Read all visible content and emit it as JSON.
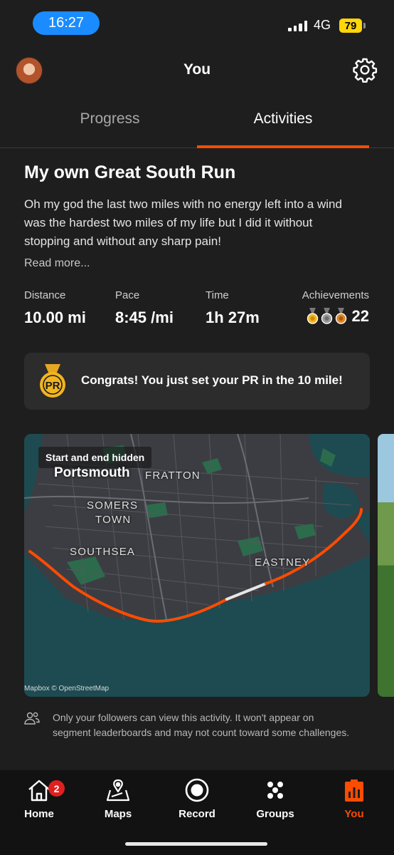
{
  "status_bar": {
    "time": "16:27",
    "network": "4G",
    "battery": "79"
  },
  "header": {
    "title": "You"
  },
  "tabs": [
    {
      "label": "Progress",
      "active": false
    },
    {
      "label": "Activities",
      "active": true
    }
  ],
  "activity": {
    "title": "My own Great South Run",
    "description": "Oh my god the last two miles with no energy left into a wind was the hardest two miles of my life but I did it without stopping and without any sharp pain!",
    "read_more": "Read more...",
    "stats": [
      {
        "label": "Distance",
        "value": "10.00 mi"
      },
      {
        "label": "Pace",
        "value": "8:45 /mi"
      },
      {
        "label": "Time",
        "value": "1h 27m"
      }
    ],
    "achievements": {
      "label": "Achievements",
      "count": "22"
    },
    "pr_message": "Congrats! You just set your PR in the 10 mile!",
    "pr_badge_text": "PR",
    "map": {
      "hidden_label": "Start and end hidden",
      "city": "Portsmouth",
      "labels": [
        "FRATTON",
        "SOMERS",
        "TOWN",
        "SOUTHSEA",
        "EASTNEY"
      ],
      "credit": "Mapbox © OpenStreetMap"
    },
    "privacy_note": "Only your followers can view this activity. It won't appear on segment leaderboards and may not count toward some challenges."
  },
  "nav": {
    "items": [
      {
        "label": "Home",
        "badge": "2"
      },
      {
        "label": "Maps"
      },
      {
        "label": "Record"
      },
      {
        "label": "Groups"
      },
      {
        "label": "You",
        "active": true
      }
    ]
  },
  "colors": {
    "accent": "#fc4c02",
    "background": "#1e1e1e",
    "card": "#2c2c2c",
    "status_time_pill": "#1a8cff",
    "battery": "#ffd60a"
  }
}
